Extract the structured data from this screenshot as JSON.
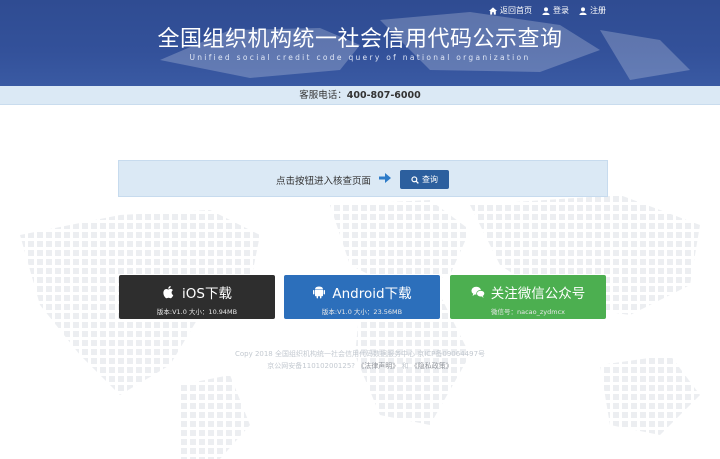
{
  "header": {
    "title": "全国组织机构统一社会信用代码公示查询",
    "subtitle": "Unified social credit code query of national organization",
    "links": [
      {
        "icon": "home-icon",
        "label": "返回首页"
      },
      {
        "icon": "user-icon",
        "label": "登录"
      },
      {
        "icon": "user-icon",
        "label": "注册"
      }
    ]
  },
  "phone_bar": {
    "label": "客服电话：",
    "number": "400-807-6000"
  },
  "query": {
    "prompt": "点击按钮进入核查页面",
    "button_label": "查询",
    "arrow_icon": "arrow-right-icon",
    "button_icon": "search-icon"
  },
  "downloads": [
    {
      "icon": "apple-icon",
      "label": "iOS下载",
      "sub": "版本:V1.0 大小：10.94MB",
      "color": "#2e2e2e"
    },
    {
      "icon": "android-icon",
      "label": "Android下载",
      "sub": "版本:V1.0 大小：23.56MB",
      "color": "#2c6fbb"
    },
    {
      "icon": "wechat-icon",
      "label": "关注微信公众号",
      "sub": "微信号：nacao_zydmcx",
      "color": "#4caf50"
    }
  ],
  "footer": {
    "line1": "Copy 2018 全国组织机构统一社会信用代码数据服务中心 京ICP备09064497号",
    "line2_prefix": "京公网安备11010200125?",
    "legal_link": "《法律声明》",
    "separator": "和",
    "privacy_link": "《隐私政策》"
  },
  "colors": {
    "header_bg": "#33519a",
    "phone_bar_bg": "#dbe9f5",
    "query_button": "#2c5f9e",
    "arrow": "#2d7bc8"
  }
}
